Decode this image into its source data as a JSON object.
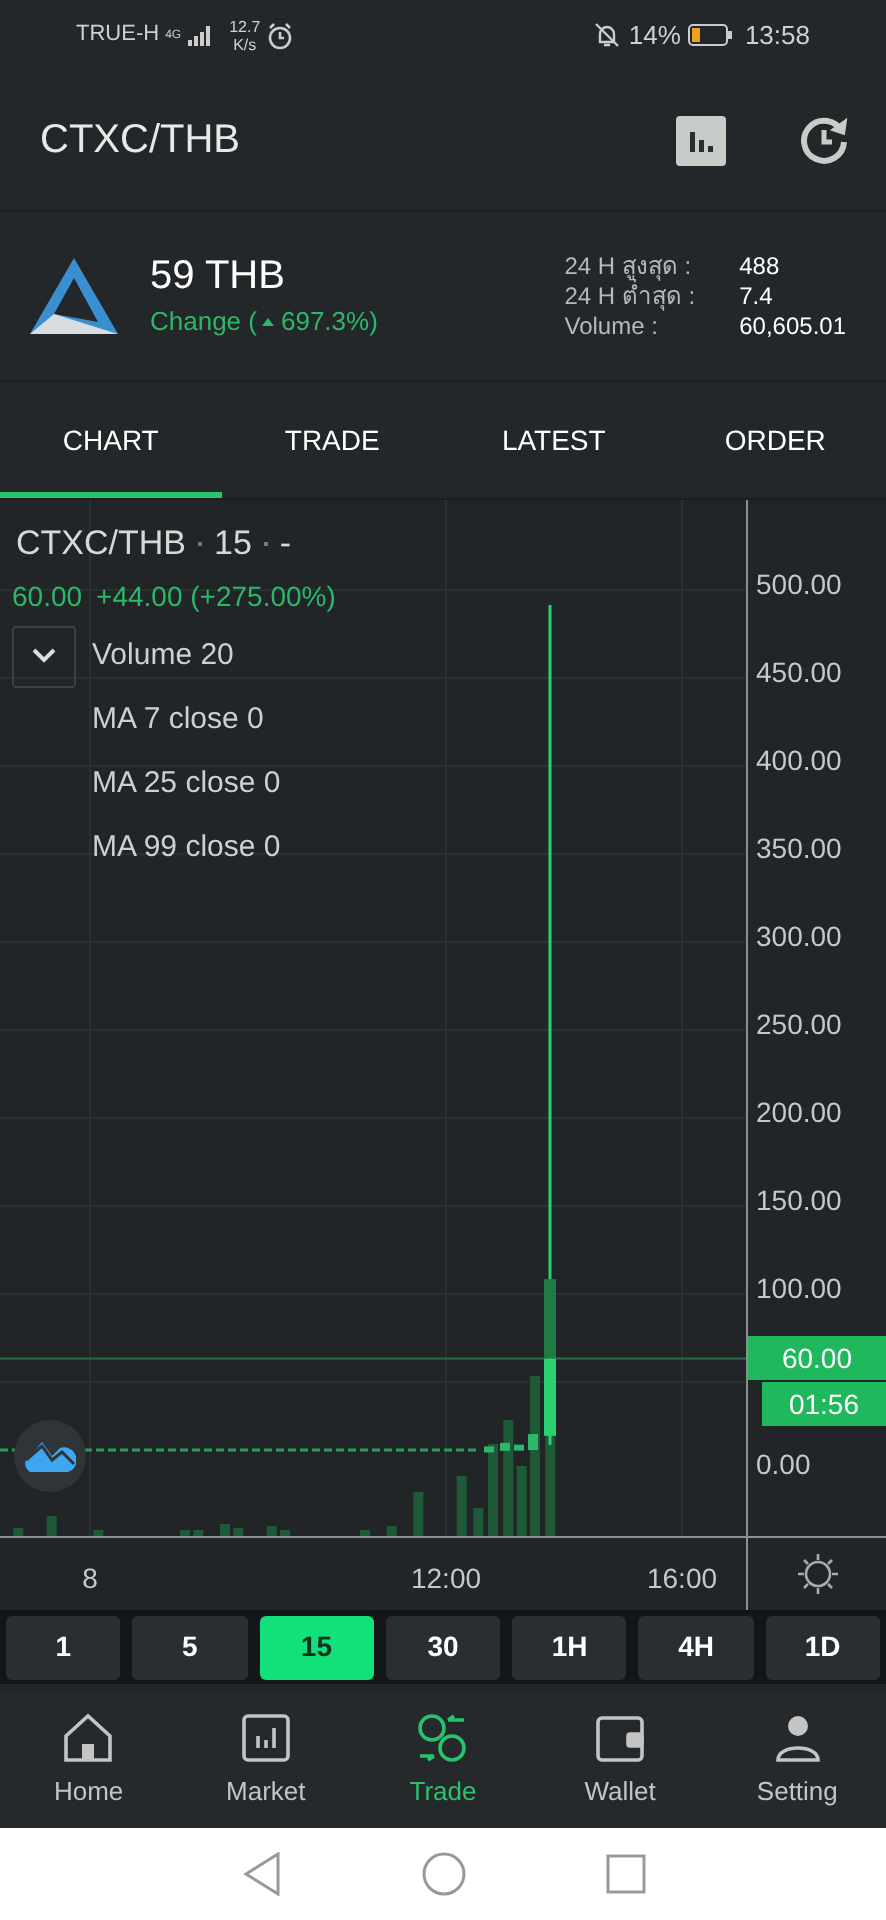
{
  "status_bar": {
    "carrier": "TRUE-H",
    "network": "4G",
    "speed_value": "12.7",
    "speed_unit": "K/s",
    "battery": "14%",
    "time": "13:58"
  },
  "header": {
    "title": "CTXC/THB"
  },
  "summary": {
    "price": "59 THB",
    "change_label": "Change (",
    "change_value": "697.3%)",
    "stats": [
      {
        "label": "24 H สูงสุด :",
        "value": "488"
      },
      {
        "label": "24 H ต่ำสุด :",
        "value": "7.4"
      },
      {
        "label": "Volume :",
        "value": "60,605.01"
      }
    ]
  },
  "tabs": [
    {
      "label": "CHART",
      "selected": true
    },
    {
      "label": "TRADE",
      "selected": false
    },
    {
      "label": "LATEST",
      "selected": false
    },
    {
      "label": "ORDER",
      "selected": false
    }
  ],
  "chart": {
    "symbol": "CTXC/THB",
    "interval": "15",
    "status": "-",
    "last": "60.00",
    "change": "+44.00 (+275.00%)",
    "indicators": [
      "Volume 20",
      "MA 7 close 0",
      "MA 25 close 0",
      "MA 99 close 0"
    ],
    "price_labels": [
      "500.00",
      "450.00",
      "400.00",
      "350.00",
      "300.00",
      "250.00",
      "200.00",
      "150.00",
      "100.00",
      "0.00"
    ],
    "price_tag": "60.00",
    "countdown": "01:56",
    "time_labels": [
      "8",
      "12:00",
      "16:00"
    ]
  },
  "intervals": [
    {
      "label": "1",
      "selected": false
    },
    {
      "label": "5",
      "selected": false
    },
    {
      "label": "15",
      "selected": true
    },
    {
      "label": "30",
      "selected": false
    },
    {
      "label": "1H",
      "selected": false
    },
    {
      "label": "4H",
      "selected": false
    },
    {
      "label": "1D",
      "selected": false
    }
  ],
  "nav": [
    {
      "label": "Home",
      "kind": "home",
      "selected": false
    },
    {
      "label": "Market",
      "kind": "market",
      "selected": false
    },
    {
      "label": "Trade",
      "kind": "trade",
      "selected": true
    },
    {
      "label": "Wallet",
      "kind": "wallet",
      "selected": false
    },
    {
      "label": "Setting",
      "kind": "setting",
      "selected": false
    }
  ]
}
